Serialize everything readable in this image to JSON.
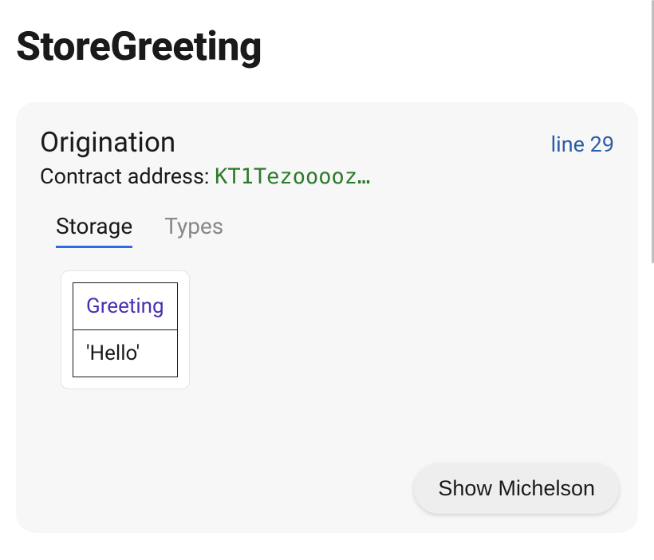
{
  "title": "StoreGreeting",
  "card": {
    "heading": "Origination",
    "line_link": "line 29",
    "contract_label": "Contract address: ",
    "contract_address": "KT1Tezooooz…"
  },
  "tabs": {
    "storage": "Storage",
    "types": "Types"
  },
  "storage": {
    "key": "Greeting",
    "value": "'Hello'"
  },
  "actions": {
    "show_michelson": "Show Michelson"
  }
}
